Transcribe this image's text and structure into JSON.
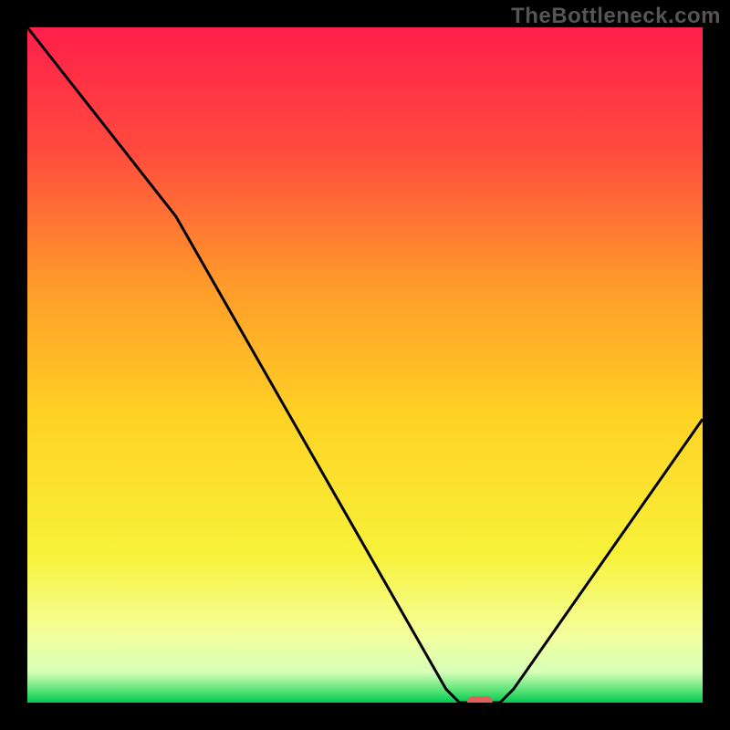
{
  "watermark": "TheBottleneck.com",
  "chart_data": {
    "type": "line",
    "title": "",
    "xlabel": "",
    "ylabel": "",
    "xlim": [
      0,
      100
    ],
    "ylim": [
      0,
      100
    ],
    "optimal_x": 67,
    "curve": [
      {
        "x": 0,
        "y": 100
      },
      {
        "x": 22,
        "y": 72
      },
      {
        "x": 62,
        "y": 2
      },
      {
        "x": 64,
        "y": 0
      },
      {
        "x": 70,
        "y": 0
      },
      {
        "x": 72,
        "y": 2
      },
      {
        "x": 100,
        "y": 42
      }
    ],
    "gradient_stops": [
      {
        "offset": 0.0,
        "color": "#ff1f4b"
      },
      {
        "offset": 0.18,
        "color": "#ff4a3e"
      },
      {
        "offset": 0.38,
        "color": "#ff9a2a"
      },
      {
        "offset": 0.58,
        "color": "#ffd324"
      },
      {
        "offset": 0.78,
        "color": "#f8f23a"
      },
      {
        "offset": 0.9,
        "color": "#f3ff9d"
      },
      {
        "offset": 0.955,
        "color": "#d7ffb8"
      },
      {
        "offset": 0.985,
        "color": "#4be06f"
      },
      {
        "offset": 1.0,
        "color": "#00c853"
      }
    ],
    "marker": {
      "x": 67,
      "y": 0,
      "color": "#e0605c",
      "rx": 14,
      "ry": 7
    }
  }
}
